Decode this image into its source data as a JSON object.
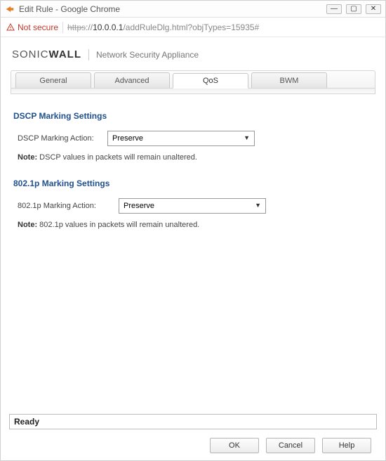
{
  "window": {
    "title": "Edit Rule - Google Chrome"
  },
  "address": {
    "not_secure": "Not secure",
    "https": "https",
    "sep": "://",
    "host": "10.0.0.1",
    "path": "/addRuleDlg.html?objTypes=15935#"
  },
  "brand": {
    "name_a": "SONIC",
    "name_b": "WALL",
    "subtitle": "Network Security Appliance"
  },
  "tabs": {
    "general": "General",
    "advanced": "Advanced",
    "qos": "QoS",
    "bwm": "BWM",
    "active": "qos"
  },
  "dscp": {
    "title": "DSCP Marking Settings",
    "label": "DSCP Marking Action:",
    "value": "Preserve",
    "note_prefix": "Note:",
    "note_text": " DSCP values in packets will remain unaltered."
  },
  "p8021": {
    "title": "802.1p Marking Settings",
    "label": "802.1p Marking Action:",
    "value": "Preserve",
    "note_prefix": "Note:",
    "note_text": " 802.1p values in packets will remain unaltered."
  },
  "status": "Ready",
  "buttons": {
    "ok": "OK",
    "cancel": "Cancel",
    "help": "Help"
  }
}
